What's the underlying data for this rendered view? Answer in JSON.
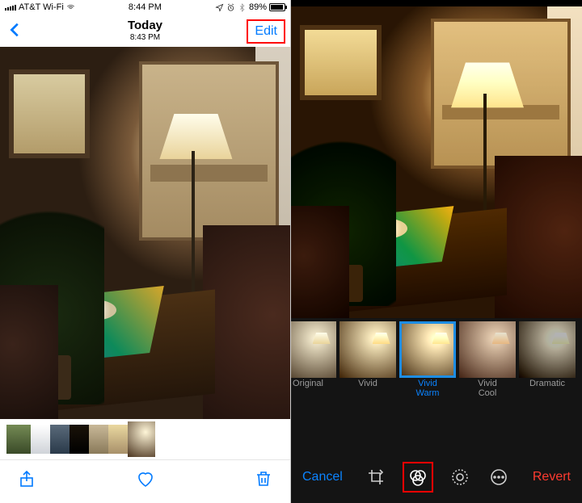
{
  "status": {
    "carrier": "AT&T Wi-Fi",
    "time": "8:44 PM",
    "battery_pct": "89%"
  },
  "nav": {
    "title": "Today",
    "subtitle": "8:43 PM",
    "edit": "Edit"
  },
  "filters": {
    "original": "Original",
    "vivid": "Vivid",
    "vivid_warm_l1": "Vivid",
    "vivid_warm_l2": "Warm",
    "vivid_cool_l1": "Vivid",
    "vivid_cool_l2": "Cool",
    "dramatic": "Dramatic"
  },
  "edit_toolbar": {
    "cancel": "Cancel",
    "revert": "Revert"
  }
}
